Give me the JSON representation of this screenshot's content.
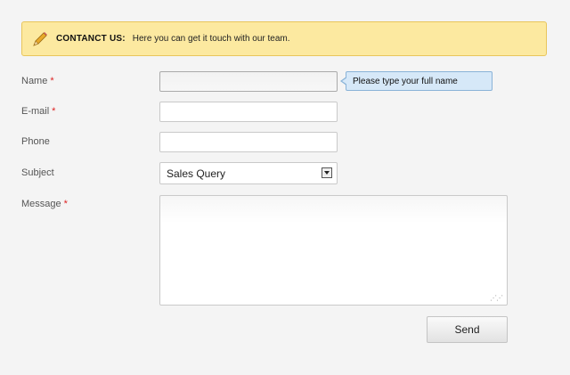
{
  "notice": {
    "title": "CONTANCT US:",
    "text": "Here you can get it touch with our team."
  },
  "form": {
    "required_marker": "*",
    "name": {
      "label": "Name",
      "value": "",
      "required": true
    },
    "email": {
      "label": "E-mail",
      "value": "",
      "required": true
    },
    "phone": {
      "label": "Phone",
      "value": "",
      "required": false
    },
    "subject": {
      "label": "Subject",
      "selected": "Sales Query"
    },
    "message": {
      "label": "Message",
      "value": "",
      "required": true
    },
    "tooltip": "Please type your full name",
    "send_label": "Send"
  },
  "colors": {
    "notice_bg": "#fce9a0",
    "notice_border": "#e8c55b",
    "tooltip_bg": "#d6e8f8",
    "required": "#dd2222"
  },
  "icons": {
    "notice": "pencil-icon",
    "select": "chevron-down-icon",
    "resize": "resize-grip-icon"
  }
}
